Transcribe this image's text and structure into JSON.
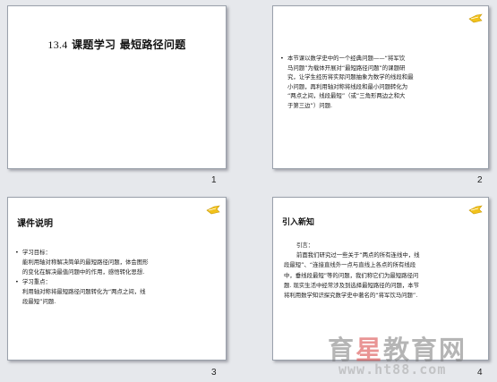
{
  "slides": [
    {
      "number": "1",
      "title_num": "13.4",
      "title_text": "课题学习 最短路径问题"
    },
    {
      "number": "2",
      "bullet": "•",
      "lines": [
        "本节课以数学史中的一个经典问题——“将军饮",
        "马问题”为载体开展对“最短路径问题”的课题研",
        "究，让学生经历将实际问题抽象为数学的线段和最",
        "小问题，再利用轴对称将线段和最小问题转化为",
        "“两点之间，线段最短”（或“三角形两边之和大",
        "于第三边”）问题."
      ]
    },
    {
      "number": "3",
      "heading": "课件说明",
      "goal_label": "学习目标：",
      "goal_lines": [
        "能利用轴对称解决简单的最短路径问题，体会图形",
        "的变化在解决最值问题中的作用，感悟转化思想."
      ],
      "key_label": "学习重点：",
      "key_lines": [
        "利用轴对称将最短路径问题转化为“两点之间，线",
        "段最短”问题."
      ]
    },
    {
      "number": "4",
      "heading": "引入新知",
      "intro_label": "引言：",
      "para_lines": [
        "前面我们研究过一些关于“两点的所有连线中，线",
        "段最短”、“连接直线外一点与直线上各点的所有线段",
        "中，垂线段最短”等的问题，我们称它们为最短路径问",
        "题. 现实生活中经常涉及到选择最短路径的问题，本节",
        "将利用数学知识探究数学史中著名的“将军饮马问题”."
      ]
    }
  ],
  "watermark": {
    "text_a": "育",
    "text_star": "星",
    "text_b": "教育网",
    "url": "www.ht88.com"
  },
  "colors": {
    "logo_yellow": "#f2c21b",
    "background": "#e6e8ec"
  }
}
